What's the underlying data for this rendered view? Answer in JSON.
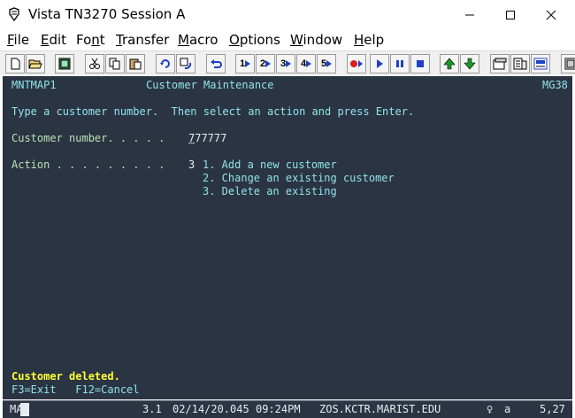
{
  "window": {
    "title": "Vista TN3270 Session A",
    "min_glyph": "—",
    "max_glyph": "☐",
    "close_glyph": "✕"
  },
  "menu": [
    {
      "label": "File",
      "u": "F",
      "rest": "ile"
    },
    {
      "label": "Edit",
      "u": "E",
      "rest": "dit"
    },
    {
      "label": "Font",
      "pre": "Fo",
      "u": "n",
      "rest": "t"
    },
    {
      "label": "Transfer",
      "u": "T",
      "rest": "ransfer"
    },
    {
      "label": "Macro",
      "u": "M",
      "rest": "acro"
    },
    {
      "label": "Options",
      "u": "O",
      "rest": "ptions"
    },
    {
      "label": "Window",
      "u": "W",
      "rest": "indow"
    },
    {
      "label": "Help",
      "u": "H",
      "rest": "elp"
    }
  ],
  "toolbar": {
    "macro_numbers": [
      "1",
      "2",
      "3",
      "4",
      "5"
    ],
    "icons": [
      "new-session-icon",
      "open-folder-icon",
      "display-icon",
      "cut-icon",
      "copy-icon",
      "paste-icon",
      "reconnect-icon",
      "switch-session-icon",
      "undo-icon",
      "record-icon",
      "play-icon",
      "step-icon",
      "pause-icon",
      "stop-icon",
      "upload-icon",
      "download-icon",
      "properties-icon",
      "clipboard-icon",
      "keyboard-map-icon",
      "settings-icon"
    ]
  },
  "terminal": {
    "map_name": "MNTMAP1",
    "screen_title": "Customer Maintenance",
    "map_id": "MG38",
    "instruction": "Type a customer number.  Then select an action and press Enter.",
    "customer_label": "Customer number. . . . .",
    "customer_value_first": "7",
    "customer_value_rest": "77777",
    "action_label": "Action . . . . . . . . .",
    "action_value": "3",
    "options": [
      "1. Add a new customer",
      "2. Change an existing customer",
      "3. Delete an existing"
    ],
    "message": "Customer deleted.",
    "pf_keys": "F3=Exit   F12=Cancel"
  },
  "status": {
    "indicator": "MA",
    "version": "3.1",
    "date": "02/14/20.045",
    "time": "09:24PM",
    "host": "ZOS.KCTR.MARIST.EDU",
    "lock_glyph": "♀",
    "mode": "a",
    "cursor_pos": "5,27"
  },
  "colors": {
    "terminal_bg": "#2b3443",
    "cyan_text": "#8fe3ea",
    "field_text": "#e8ecf0",
    "message_text": "#ffff33"
  }
}
